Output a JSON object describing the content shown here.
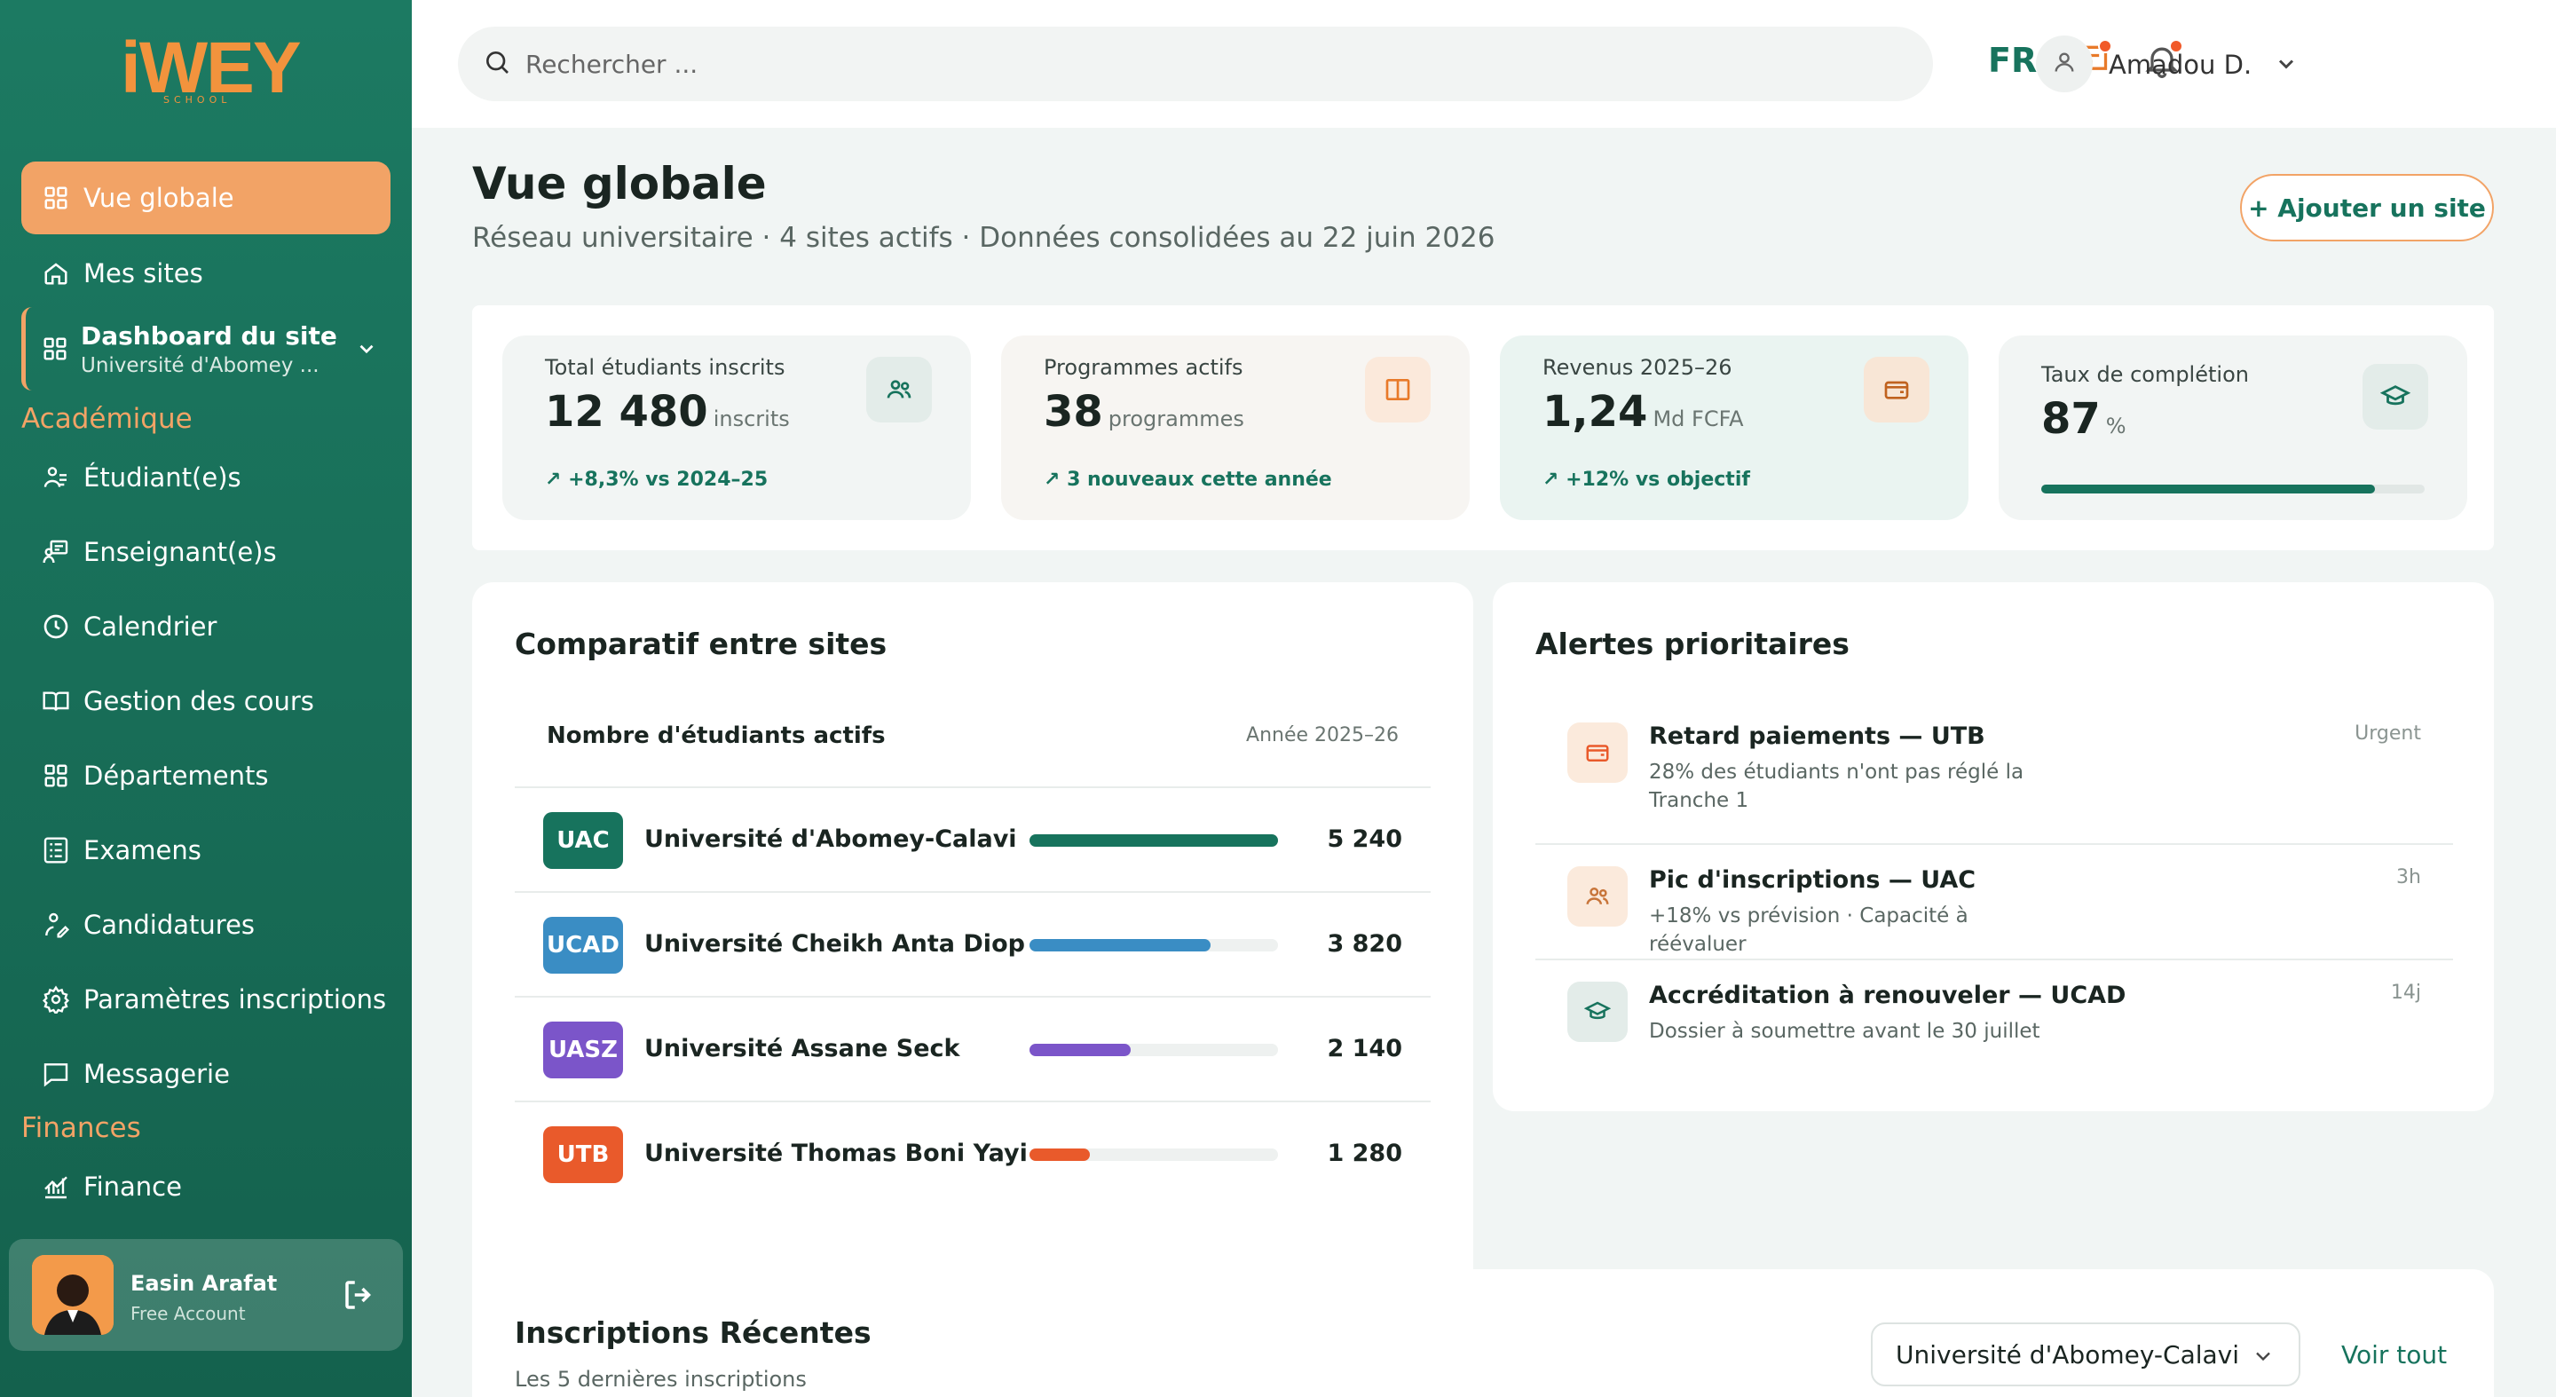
{
  "brand": {
    "logo": "iWEY",
    "logo_sub": "SCHOOL"
  },
  "sidebar": {
    "items_top": [
      {
        "label": "Vue globale",
        "icon": "grid-icon",
        "active": true
      },
      {
        "label": "Mes sites",
        "icon": "home-icon"
      }
    ],
    "dashboard": {
      "label": "Dashboard du site",
      "sublabel": "Université d'Abomey ..."
    },
    "section_academic": "Académique",
    "items_academic": [
      {
        "label": "Étudiant(e)s",
        "icon": "students-icon"
      },
      {
        "label": "Enseignant(e)s",
        "icon": "teacher-icon"
      },
      {
        "label": "Calendrier",
        "icon": "clock-icon"
      },
      {
        "label": "Gestion des cours",
        "icon": "book-icon"
      },
      {
        "label": "Départements",
        "icon": "grid-icon"
      },
      {
        "label": "Examens",
        "icon": "exam-icon"
      },
      {
        "label": "Candidatures",
        "icon": "application-icon"
      },
      {
        "label": "Paramètres inscriptions",
        "icon": "gear-icon"
      },
      {
        "label": "Messagerie",
        "icon": "message-icon"
      }
    ],
    "section_finance": "Finances",
    "items_finance": [
      {
        "label": "Finance",
        "icon": "chart-icon"
      }
    ],
    "user": {
      "name": "Easin Arafat",
      "plan": "Free Account"
    }
  },
  "topbar": {
    "search_placeholder": "Rechercher ...",
    "language": "FR",
    "profile_name": "Amadou D."
  },
  "page": {
    "title": "Vue globale",
    "subtitle": "Réseau universitaire · 4 sites actifs · Données consolidées au 22 juin 2026",
    "add_button": "+ Ajouter un site"
  },
  "stats": [
    {
      "label": "Total étudiants inscrits",
      "value": "12 480",
      "unit": "inscrits",
      "trend": "+8,3% vs 2024–25",
      "icon": "users-icon",
      "bg": "#f2f5f4",
      "icon_bg": "#e3ece9"
    },
    {
      "label": "Programmes actifs",
      "value": "38",
      "unit": "programmes",
      "trend": "3 nouveaux cette année",
      "icon": "book-open-icon",
      "bg": "#f7f5f2",
      "icon_bg": "#fbe9db"
    },
    {
      "label": "Revenus 2025–26",
      "value": "1,24",
      "unit": "Md FCFA",
      "trend": "+12% vs objectif",
      "icon": "wallet-icon",
      "bg": "#eaf4f1",
      "icon_bg": "#f8e6d6"
    },
    {
      "label": "Taux de complétion",
      "value": "87",
      "unit": "%",
      "progress": 87,
      "icon": "graduation-cap-icon",
      "bg": "#f2f5f4",
      "icon_bg": "#e3ece9"
    }
  ],
  "comparatif": {
    "title": "Comparatif entre sites",
    "metric": "Nombre d'étudiants actifs",
    "year": "Année 2025–26",
    "max": 5240,
    "rows": [
      {
        "code": "UAC",
        "name": "Université d'Abomey-Calavi",
        "value": 5240,
        "display": "5 240",
        "color": "#17735d"
      },
      {
        "code": "UCAD",
        "name": "Université Cheikh Anta Diop",
        "value": 3820,
        "display": "3 820",
        "color": "#3a8dc4"
      },
      {
        "code": "UASZ",
        "name": "Université Assane Seck",
        "value": 2140,
        "display": "2 140",
        "color": "#7b55c9"
      },
      {
        "code": "UTB",
        "name": "Université Thomas Boni Yayi",
        "value": 1280,
        "display": "1 280",
        "color": "#e95a2b"
      }
    ]
  },
  "alerts": {
    "title": "Alertes prioritaires",
    "items": [
      {
        "title": "Retard paiements — UTB",
        "desc": "28% des étudiants n'ont pas réglé la Tranche 1",
        "time": "Urgent",
        "icon": "wallet-icon",
        "icon_bg": "#fbeadc",
        "icon_color": "#e95a2b"
      },
      {
        "title": "Pic d'inscriptions — UAC",
        "desc": "+18% vs prévision · Capacité à réévaluer",
        "time": "3h",
        "icon": "users-icon",
        "icon_bg": "#fbeadc",
        "icon_color": "#c8753a"
      },
      {
        "title": "Accréditation à renouveler — UCAD",
        "desc": "Dossier à soumettre avant le 30 juillet",
        "time": "14j",
        "icon": "graduation-cap-icon",
        "icon_bg": "#e3ece9",
        "icon_color": "#17735d"
      }
    ]
  },
  "recent": {
    "title": "Inscriptions Récentes",
    "subtitle": "Les 5 dernières inscriptions",
    "select_value": "Université d'Abomey-Calavi",
    "see_all": "Voir tout"
  },
  "colors": {
    "primary": "#17735d",
    "accent": "#f2a366",
    "sidebar": "#1c7a62"
  }
}
